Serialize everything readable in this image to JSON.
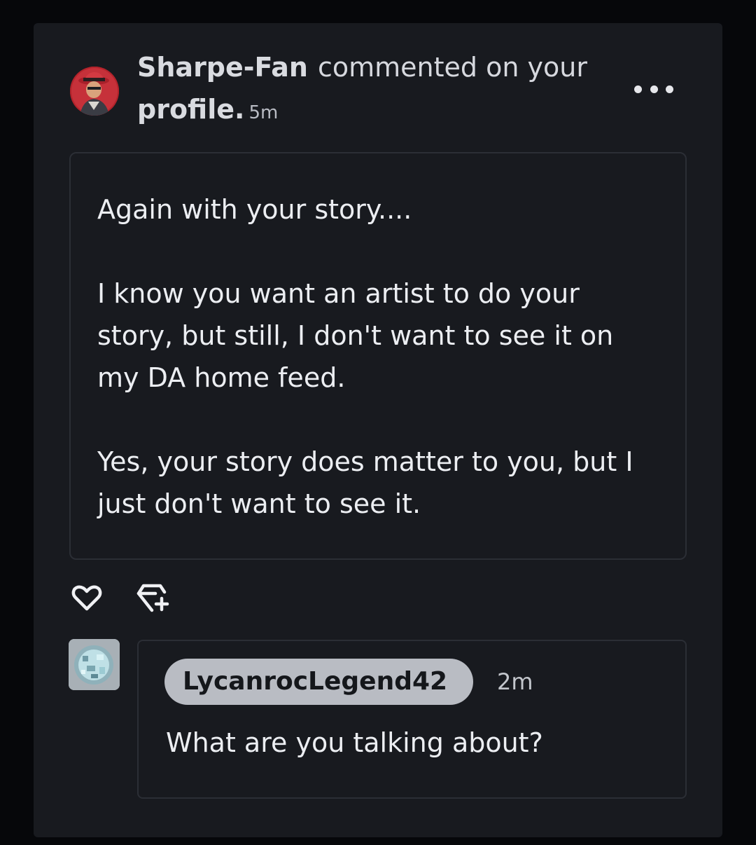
{
  "notification": {
    "username": "Sharpe-Fan",
    "action_text": "commented on your",
    "target_text": "profile.",
    "time": "5m"
  },
  "comment": {
    "paragraphs": [
      "Again with your story....",
      "I know you want an artist to do your story, but still, I don't want to see it on my DA home feed.",
      "Yes, your story does matter to you, but I just don't want to see it."
    ]
  },
  "reply": {
    "username": "LycanrocLegend42",
    "time": "2m",
    "text": "What are you talking about?"
  },
  "icons": {
    "more": "more-horizontal-icon",
    "like": "heart-icon",
    "fave": "gem-plus-icon"
  },
  "colors": {
    "background": "#06070a",
    "card": "#181a1f",
    "username_pill": "#b9bcc3"
  }
}
